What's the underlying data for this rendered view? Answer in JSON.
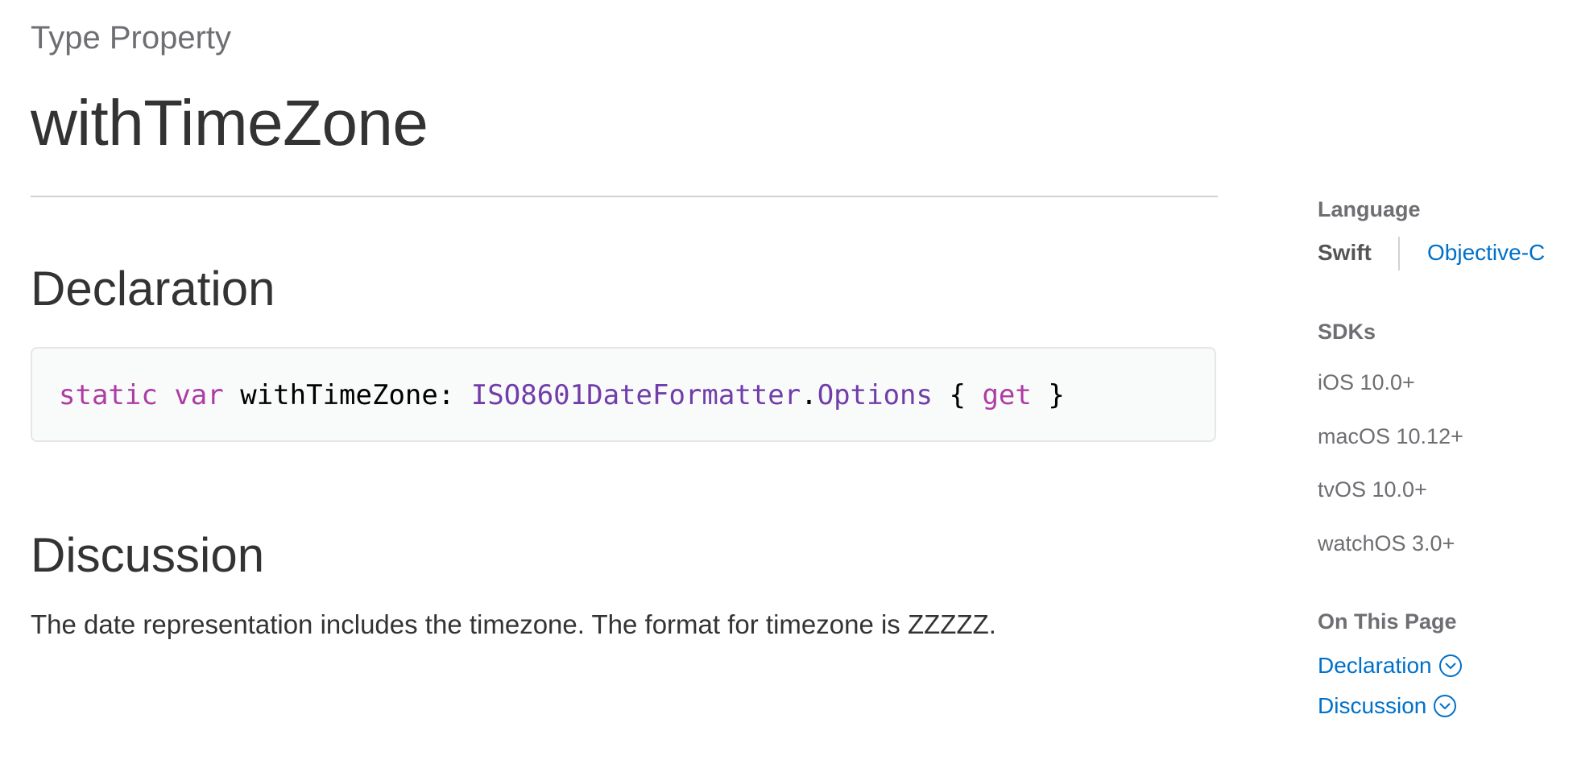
{
  "header": {
    "eyebrow": "Type Property",
    "title": "withTimeZone"
  },
  "declaration": {
    "heading": "Declaration",
    "code_tokens": {
      "static": "static",
      "var": "var",
      "name": "withTimeZone:",
      "type_a": "ISO8601DateFormatter",
      "dot": ".",
      "type_b": "Options",
      "brace_open": "{",
      "get": "get",
      "brace_close": "}"
    }
  },
  "discussion": {
    "heading": "Discussion",
    "text": "The date representation includes the timezone. The format for timezone is ZZZZZ."
  },
  "sidebar": {
    "language_label": "Language",
    "languages": [
      "Swift",
      "Objective-C"
    ],
    "sdks_label": "SDKs",
    "sdks": [
      "iOS 10.0+",
      "macOS 10.12+",
      "tvOS 10.0+",
      "watchOS 3.0+"
    ],
    "on_this_page_label": "On This Page",
    "on_this_page": [
      "Declaration",
      "Discussion"
    ]
  },
  "colors": {
    "link": "#0070c9",
    "keyword": "#ad3da4",
    "type": "#703daa",
    "text": "#333333",
    "muted": "#6e6e73"
  },
  "icons": {
    "section_link": "chevron-down-circle-icon"
  }
}
